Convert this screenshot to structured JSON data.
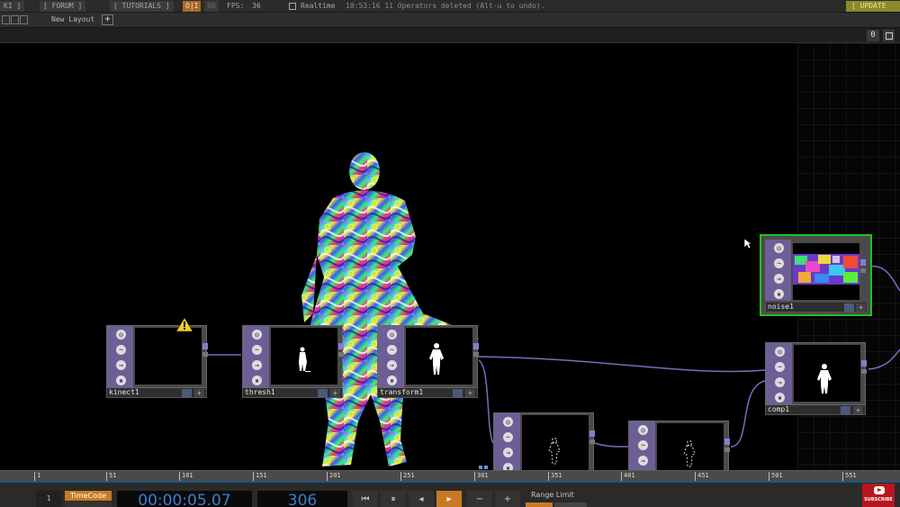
{
  "topbar": {
    "wiki": "KI ]",
    "forum": "[ FORUM ]",
    "tutorials": "[ TUTORIALS ]",
    "oi": "O|I",
    "fps_target": "60",
    "fps_label": "FPS:",
    "fps_value": "36",
    "realtime": "Realtime",
    "status": "10:53:16 11 Operators deleted (Alt-u to undo).",
    "update": "[ UPDATE"
  },
  "layoutbar": {
    "layout_name": "New Layout",
    "add": "+"
  },
  "pathbar": {
    "zero": "0"
  },
  "nodes": {
    "kinect1": {
      "name": "kinect1"
    },
    "thresh1": {
      "name": "thresh1"
    },
    "transform1": {
      "name": "transform1"
    },
    "noise1": {
      "name": "noise1"
    },
    "comp1": {
      "name": "comp1"
    }
  },
  "node_icons": [
    "target-icon",
    "wave-icon",
    "arrow-icon",
    "lock-icon"
  ],
  "timeline": {
    "ticks": [
      "1",
      "51",
      "101",
      "151",
      "201",
      "251",
      "301",
      "351",
      "401",
      "451",
      "501",
      "551"
    ],
    "one": "1",
    "timecode_label": "TimeCode",
    "timecode": "00:00:05.07",
    "frame": "306",
    "buttons": {
      "to_start": "⏮",
      "pause": "⏸",
      "step_back": "◂",
      "play": "▸",
      "minus": "−",
      "plus": "+"
    },
    "range_limit": "Range Limit"
  },
  "youtube": {
    "label": "SUBSCRIBE"
  },
  "colors": {
    "accent": "#c87a22",
    "operator_strip": "#6d5f96",
    "selected": "#22c022",
    "timecode_text": "#3c7ed0"
  }
}
